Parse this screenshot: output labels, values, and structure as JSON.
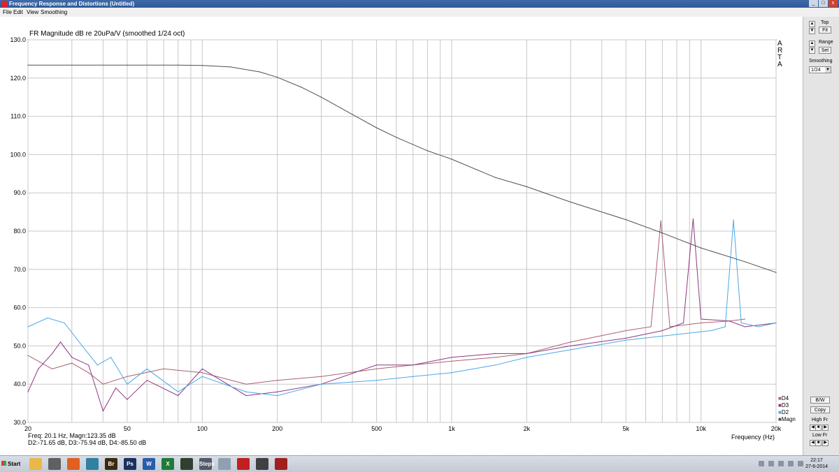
{
  "window": {
    "title": "Frequency Response and Distortions (Untitled)",
    "min": "_",
    "max": "□",
    "close": "x"
  },
  "menu": [
    "File",
    "Edit",
    "View",
    "Smoothing"
  ],
  "chart_data": {
    "type": "line",
    "title": "FR Magnitude dB re 20uPa/V (smoothed 1/24 oct)",
    "xlabel": "Frequency (Hz)",
    "ylabel": "",
    "xscale": "log",
    "xlim": [
      20,
      20000
    ],
    "ylim": [
      30,
      130
    ],
    "grid": true,
    "legend_placement": "bottom-right",
    "y_ticks": [
      "130.0",
      "120.0",
      "110.0",
      "100.0",
      "90.0",
      "80.0",
      "70.0",
      "60.0",
      "50.0",
      "40.0",
      "30.0"
    ],
    "x_tick_labels": [
      {
        "v": 20,
        "label": "20"
      },
      {
        "v": 50,
        "label": "50"
      },
      {
        "v": 100,
        "label": "100"
      },
      {
        "v": 200,
        "label": "200"
      },
      {
        "v": 500,
        "label": "500"
      },
      {
        "v": 1000,
        "label": "1k"
      },
      {
        "v": 2000,
        "label": "2k"
      },
      {
        "v": 5000,
        "label": "5k"
      },
      {
        "v": 10000,
        "label": "10k"
      },
      {
        "v": 20000,
        "label": "20k"
      }
    ],
    "series": [
      {
        "name": "Magn",
        "color": "#505050",
        "points": [
          [
            20,
            123.4
          ],
          [
            50,
            123.4
          ],
          [
            80,
            123.4
          ],
          [
            100,
            123.3
          ],
          [
            130,
            122.9
          ],
          [
            170,
            121.6
          ],
          [
            200,
            120.2
          ],
          [
            250,
            117.6
          ],
          [
            300,
            115.0
          ],
          [
            400,
            110.5
          ],
          [
            500,
            107.0
          ],
          [
            600,
            104.5
          ],
          [
            800,
            101.0
          ],
          [
            1000,
            98.8
          ],
          [
            1500,
            94.0
          ],
          [
            2000,
            91.6
          ],
          [
            3000,
            87.6
          ],
          [
            5000,
            83.0
          ],
          [
            7000,
            79.5
          ],
          [
            10000,
            75.6
          ],
          [
            15000,
            72.0
          ],
          [
            20000,
            69.2
          ]
        ]
      },
      {
        "name": "D2",
        "color": "#4aa8e8",
        "points": [
          [
            20,
            55
          ],
          [
            24,
            57.3
          ],
          [
            28,
            56
          ],
          [
            33,
            50
          ],
          [
            38,
            45
          ],
          [
            43,
            47
          ],
          [
            50,
            40
          ],
          [
            60,
            44
          ],
          [
            80,
            38
          ],
          [
            100,
            42
          ],
          [
            150,
            38
          ],
          [
            200,
            37
          ],
          [
            300,
            40
          ],
          [
            500,
            41
          ],
          [
            700,
            42
          ],
          [
            1000,
            43
          ],
          [
            1500,
            45
          ],
          [
            2000,
            47
          ],
          [
            3000,
            49
          ],
          [
            5000,
            51.5
          ],
          [
            8000,
            53
          ],
          [
            11000,
            54
          ],
          [
            12500,
            55
          ],
          [
            13500,
            82.9
          ],
          [
            14500,
            56
          ],
          [
            17000,
            55
          ],
          [
            20000,
            56
          ]
        ]
      },
      {
        "name": "D3",
        "color": "#8c3880",
        "points": [
          [
            20,
            38
          ],
          [
            22,
            44
          ],
          [
            25,
            48
          ],
          [
            27,
            51
          ],
          [
            30,
            47
          ],
          [
            35,
            45
          ],
          [
            40,
            33
          ],
          [
            45,
            39
          ],
          [
            50,
            36
          ],
          [
            60,
            41
          ],
          [
            80,
            37
          ],
          [
            100,
            44
          ],
          [
            150,
            37
          ],
          [
            200,
            38
          ],
          [
            300,
            40
          ],
          [
            500,
            45
          ],
          [
            700,
            45
          ],
          [
            1000,
            47
          ],
          [
            1500,
            48
          ],
          [
            2000,
            48
          ],
          [
            3000,
            50
          ],
          [
            5000,
            52
          ],
          [
            7000,
            54
          ],
          [
            8500,
            56
          ],
          [
            9300,
            83.2
          ],
          [
            10000,
            57
          ],
          [
            13000,
            56.5
          ],
          [
            15000,
            55
          ],
          [
            20000,
            56
          ]
        ]
      },
      {
        "name": "D4",
        "color": "#a86070",
        "points": [
          [
            20,
            47.5
          ],
          [
            25,
            44
          ],
          [
            30,
            45.5
          ],
          [
            35,
            43
          ],
          [
            40,
            40
          ],
          [
            50,
            42
          ],
          [
            70,
            44
          ],
          [
            100,
            43
          ],
          [
            150,
            40
          ],
          [
            200,
            41
          ],
          [
            300,
            42
          ],
          [
            500,
            44
          ],
          [
            700,
            45
          ],
          [
            1000,
            46
          ],
          [
            1500,
            47
          ],
          [
            2000,
            48
          ],
          [
            3000,
            51
          ],
          [
            5000,
            54
          ],
          [
            6300,
            55
          ],
          [
            6900,
            82.7
          ],
          [
            7500,
            55
          ],
          [
            10000,
            56
          ],
          [
            13000,
            56.5
          ],
          [
            15000,
            57
          ]
        ]
      }
    ],
    "cursor_readout": [
      "Freq: 20.1 Hz, Magn:123.35 dB",
      "D2:-71.65 dB, D3:-75.94 dB, D4:-85.50 dB"
    ]
  },
  "arta_label": [
    "A",
    "R",
    "T",
    "A"
  ],
  "legend": [
    {
      "label": "D4",
      "color": "#a86070"
    },
    {
      "label": "D3",
      "color": "#8c3880"
    },
    {
      "label": "D2",
      "color": "#4aa8e8"
    },
    {
      "label": "Magn",
      "color": "#505050"
    }
  ],
  "right_panel": {
    "top_label": "Top",
    "fit": "Fit",
    "range_label": "Range",
    "set": "Set",
    "smoothing_label": "Smoothing",
    "smoothing_value": "1/24",
    "bw": "B/W",
    "copy": "Copy",
    "high_fr": "High Fr",
    "low_fr": "Low Fr"
  },
  "taskbar": {
    "start": "Start",
    "apps": [
      {
        "name": "folder",
        "label": "",
        "color": "#e8b84a"
      },
      {
        "name": "photo",
        "label": "",
        "color": "#606060"
      },
      {
        "name": "firefox",
        "label": "",
        "color": "#e06020"
      },
      {
        "name": "app4",
        "label": "",
        "color": "#3080a0"
      },
      {
        "name": "bridge",
        "label": "Br",
        "color": "#3a2a10"
      },
      {
        "name": "photoshop",
        "label": "Ps",
        "color": "#1a3060"
      },
      {
        "name": "word",
        "label": "W",
        "color": "#2a5cab"
      },
      {
        "name": "excel",
        "label": "X",
        "color": "#1f7a3a"
      },
      {
        "name": "scope",
        "label": "",
        "color": "#304030"
      },
      {
        "name": "steps",
        "label": "Steps",
        "color": "#505a6a"
      },
      {
        "name": "calc",
        "label": "",
        "color": "#90a0b0"
      },
      {
        "name": "arta",
        "label": "",
        "color": "#c02020"
      },
      {
        "name": "csp",
        "label": "",
        "color": "#404040"
      },
      {
        "name": "lt",
        "label": "",
        "color": "#a02020"
      }
    ],
    "time": "22:17",
    "date": "27-6-2014"
  }
}
